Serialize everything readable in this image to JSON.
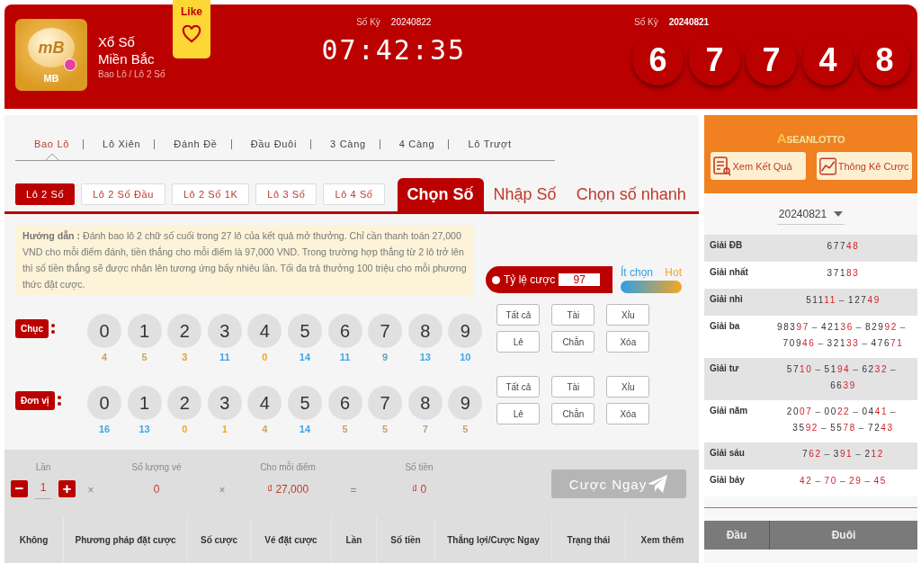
{
  "header": {
    "logo": {
      "ball_text": "mB",
      "label": "MB"
    },
    "title": "Xổ Số",
    "subtitle": "Miền Bắc",
    "breadcrumb": "Bao Lô / Lô 2 Số",
    "like": {
      "label": "Like"
    },
    "next_draw": {
      "label": "Số Kỳ",
      "period": "20240822",
      "countdown": "07:42:35"
    },
    "last_draw": {
      "label": "Số Kỳ",
      "period": "20240821",
      "balls": [
        "6",
        "7",
        "7",
        "4",
        "8"
      ]
    }
  },
  "game_tabs": [
    {
      "label": "Bao Lô",
      "selected": true
    },
    {
      "label": "Lô Xiên",
      "selected": false
    },
    {
      "label": "Đánh Đề",
      "selected": false
    },
    {
      "label": "Đầu Đuôi",
      "selected": false
    },
    {
      "label": "3 Càng",
      "selected": false
    },
    {
      "label": "4 Càng",
      "selected": false
    },
    {
      "label": "Lô Trượt",
      "selected": false
    }
  ],
  "sub_tabs": [
    {
      "label": "Lô 2 Số",
      "selected": true
    },
    {
      "label": "Lô 2 Số Đầu",
      "selected": false
    },
    {
      "label": "Lô 2 Số 1K",
      "selected": false
    },
    {
      "label": "Lô 3 Số",
      "selected": false
    },
    {
      "label": "Lô 4 Số",
      "selected": false
    }
  ],
  "mode_tabs": [
    {
      "label": "Chọn Số",
      "selected": true
    },
    {
      "label": "Nhập Số",
      "selected": false
    },
    {
      "label": "Chọn số nhanh",
      "selected": false
    }
  ],
  "guide": "**Hướng dẫn :** Đánh bao lô 2 chữ số cuối trong 27 lô của kết quả mở thưởng. Chỉ cần thanh toán 27,000 VND cho mỗi điểm đánh, tiền thắng cho mỗi điểm là 97,000 VND. Trong trường hợp thắng từ 2 lô trở lên thì số tiền thắng sẽ được nhân lên tương ứng bấy nhiêu lần. Tối đa trả thưởng 100 triệu cho mỗi phương thức đặt cược.",
  "odds": {
    "label": "Tỷ lệ cược",
    "value": "97"
  },
  "heat_legend": {
    "cold": "Ít chọn",
    "hot": "Hot"
  },
  "digit_rows": [
    {
      "label": "Chục",
      "digits": [
        {
          "digit": "0",
          "count": "4",
          "color": "#c9a463",
          "selected": false
        },
        {
          "digit": "1",
          "count": "5",
          "color": "#c9a463",
          "selected": false
        },
        {
          "digit": "2",
          "count": "3",
          "color": "#d9a03c",
          "selected": false
        },
        {
          "digit": "3",
          "count": "11",
          "color": "#3ea6e6",
          "selected": false
        },
        {
          "digit": "4",
          "count": "0",
          "color": "#f5a623",
          "selected": false
        },
        {
          "digit": "5",
          "count": "14",
          "color": "#3ea6e6",
          "selected": false
        },
        {
          "digit": "6",
          "count": "11",
          "color": "#3ea6e6",
          "selected": false
        },
        {
          "digit": "7",
          "count": "9",
          "color": "#5fa3b8",
          "selected": false
        },
        {
          "digit": "8",
          "count": "13",
          "color": "#3ea6e6",
          "selected": false
        },
        {
          "digit": "9",
          "count": "10",
          "color": "#3ea6e6",
          "selected": false
        }
      ],
      "actions": [
        "Tất cả",
        "Tài",
        "Xỉu",
        "Lẻ",
        "Chẵn",
        "Xóa"
      ]
    },
    {
      "label": "Đơn vị",
      "digits": [
        {
          "digit": "0",
          "count": "16",
          "color": "#3ea6e6",
          "selected": false
        },
        {
          "digit": "1",
          "count": "13",
          "color": "#3ea6e6",
          "selected": false
        },
        {
          "digit": "2",
          "count": "0",
          "color": "#f5a623",
          "selected": false
        },
        {
          "digit": "3",
          "count": "1",
          "color": "#f5a623",
          "selected": false
        },
        {
          "digit": "4",
          "count": "4",
          "color": "#c9a463",
          "selected": false
        },
        {
          "digit": "5",
          "count": "14",
          "color": "#3ea6e6",
          "selected": false
        },
        {
          "digit": "6",
          "count": "5",
          "color": "#c9a463",
          "selected": false
        },
        {
          "digit": "7",
          "count": "5",
          "color": "#c9a463",
          "selected": false
        },
        {
          "digit": "8",
          "count": "7",
          "color": "#b0a080",
          "selected": false
        },
        {
          "digit": "9",
          "count": "5",
          "color": "#c9a463",
          "selected": false
        }
      ],
      "actions": [
        "Tất cả",
        "Tài",
        "Xỉu",
        "Lẻ",
        "Chẵn",
        "Xóa"
      ]
    }
  ],
  "bet_bar": {
    "times": {
      "label": "Lần",
      "value": "1",
      "minus": "−",
      "plus": "+"
    },
    "op1": "×",
    "tickets": {
      "label": "Số lượng vé",
      "value": "0"
    },
    "op2": "×",
    "per_point": {
      "label": "Cho mỗi điểm",
      "value": "₫ 27,000"
    },
    "op3": "=",
    "amount": {
      "label": "Số tiền",
      "value": "₫ 0"
    },
    "submit": {
      "label": "Cược Ngay",
      "disabled": true
    }
  },
  "history_columns": [
    "Không",
    "Phương pháp đặt cược",
    "Số cược",
    "Vé đặt cược",
    "Lần",
    "Số tiền",
    "Thắng lợi/Cược Ngay",
    "Trạng thái",
    "Xem thêm"
  ],
  "sidebar": {
    "brand": {
      "first": "A",
      "rest": "SEANLOTTO"
    },
    "buttons": [
      {
        "kind": "list",
        "label": "Xem Kết Quả"
      },
      {
        "kind": "chart",
        "label": "Thông Kê Cược"
      }
    ],
    "date": "20240821",
    "results": [
      {
        "label": "Giải ĐB",
        "numbers": [
          {
            "head": "677",
            "tail": "48"
          }
        ]
      },
      {
        "label": "Giải nhất",
        "numbers": [
          {
            "head": "371",
            "tail": "83"
          }
        ]
      },
      {
        "label": "Giải nhì",
        "numbers": [
          {
            "head": "511",
            "tail": "11"
          },
          {
            "head": "127",
            "tail": "49"
          }
        ]
      },
      {
        "label": "Giải ba",
        "numbers": [
          {
            "head": "983",
            "tail": "97"
          },
          {
            "head": "421",
            "tail": "36"
          },
          {
            "head": "829",
            "tail": "92"
          },
          {
            "head": "709",
            "tail": "46"
          },
          {
            "head": "321",
            "tail": "33"
          },
          {
            "head": "476",
            "tail": "71"
          }
        ]
      },
      {
        "label": "Giải tư",
        "numbers": [
          {
            "head": "57",
            "tail": "10"
          },
          {
            "head": "51",
            "tail": "94"
          },
          {
            "head": "62",
            "tail": "32"
          },
          {
            "head": "66",
            "tail": "39"
          }
        ]
      },
      {
        "label": "Giải năm",
        "numbers": [
          {
            "head": "20",
            "tail": "07"
          },
          {
            "head": "00",
            "tail": "22"
          },
          {
            "head": "04",
            "tail": "41"
          },
          {
            "head": "35",
            "tail": "92"
          },
          {
            "head": "55",
            "tail": "78"
          },
          {
            "head": "72",
            "tail": "43"
          }
        ]
      },
      {
        "label": "Giải sáu",
        "numbers": [
          {
            "head": "7",
            "tail": "62"
          },
          {
            "head": "3",
            "tail": "91"
          },
          {
            "head": "2",
            "tail": "12"
          }
        ]
      },
      {
        "label": "Giải bảy",
        "numbers": [
          {
            "tail": "42"
          },
          {
            "tail": "70"
          },
          {
            "tail": "29"
          },
          {
            "tail": "45"
          }
        ]
      }
    ],
    "separator": "–",
    "table_columns": [
      "Đầu",
      "Đuôi"
    ]
  }
}
